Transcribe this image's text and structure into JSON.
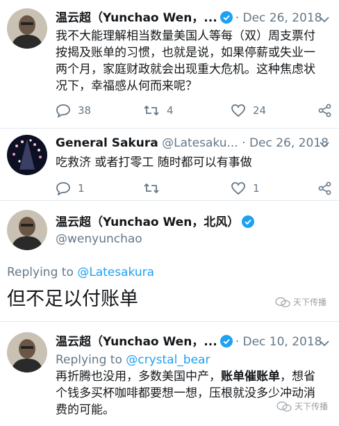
{
  "tweets": [
    {
      "name": "温云超（Yunchao Wen，...",
      "date": "Dec 26, 2018",
      "text_lines": [
        "我不大能理解相当数量美国人等每（双）周支票付",
        "按揭及账单的习惯，也就是说，如果停薪或失业一",
        "两个月，家庭财政就会出现重大危机。这种焦虑状",
        "况下，幸福感从何而来呢？"
      ],
      "replies": "38",
      "retweets": "4",
      "likes": "24"
    },
    {
      "name": "General Sakura",
      "handle": "@Latesaku...",
      "date": "Dec 26, 2018",
      "text": "吃救济 或者打零工 随时都可以有事做",
      "replies": "1",
      "retweets": "",
      "likes": "1"
    },
    {
      "name": "温云超（Yunchao Wen，北风）",
      "handle": "@wenyunchao",
      "replying_label": "Replying to",
      "replying_handle": "@Latesakura",
      "text": "但不足以付账单"
    },
    {
      "name": "温云超（Yunchao Wen，...",
      "date": "Dec 10, 2018",
      "replying_label": "Replying to",
      "replying_handle": "@crystal_bear",
      "text_line1_a": "再折腾也没用，多数美国中产，",
      "text_line1_b": "账单催账单",
      "text_line1_c": "，想省",
      "text_line2": "个钱多买杯咖啡都要想一想，压根就没多少冲动消",
      "text_line3": "费的可能。"
    }
  ],
  "watermark": "天下传播",
  "colors": {
    "verified": "#1da1f2",
    "muted": "#657786",
    "link": "#1da1f2",
    "separator": "#e1e8ed"
  },
  "icons": [
    "verified-badge-icon",
    "chevron-down-icon",
    "reply-icon",
    "retweet-icon",
    "like-icon",
    "share-icon",
    "wechat-icon"
  ]
}
